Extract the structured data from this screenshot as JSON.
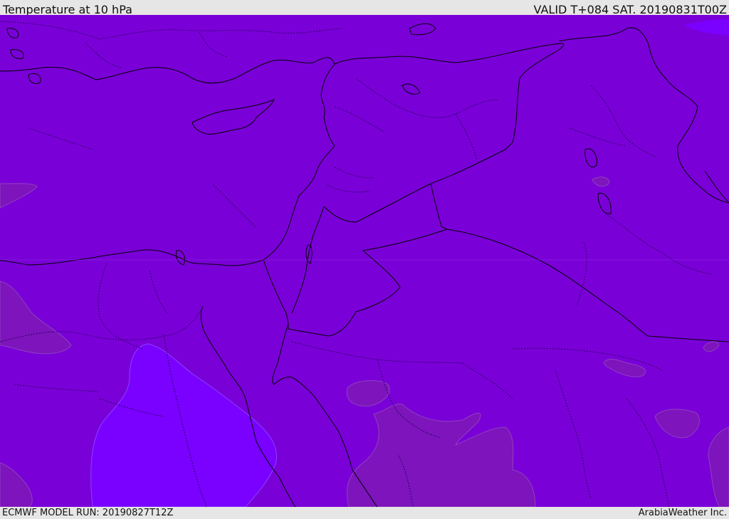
{
  "header": {
    "title": "Temperature at 10 hPa",
    "valid": "VALID T+084 SAT. 20190831T00Z"
  },
  "footer": {
    "model_run": "ECMWF MODEL RUN: 20190827T12Z",
    "credit": "ArabiaWeather Inc."
  },
  "map": {
    "field": "temperature",
    "level_hpa": 10,
    "region": "Eastern Mediterranean / Middle East",
    "colors": {
      "base": "#7a00d8",
      "warm_band": "#7d14bc",
      "cool_band": "#7a00ff",
      "coastline": "#000000",
      "border_dotted": "#2a0060"
    }
  }
}
